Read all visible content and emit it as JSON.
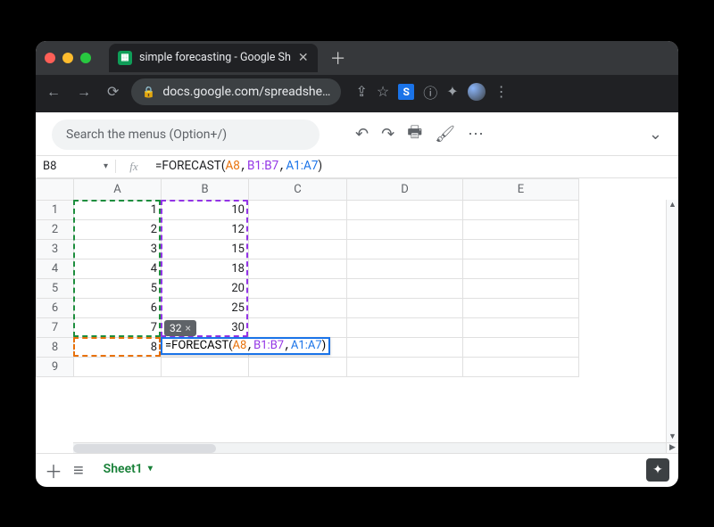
{
  "browser": {
    "tab_title": "simple forecasting - Google Sh",
    "url_display": "docs.google.com/spreadshe…"
  },
  "toolbar": {
    "search_placeholder": "Search the menus (Option+/)"
  },
  "formula_bar": {
    "namebox": "B8",
    "fx_label": "fx",
    "prefix": "=FORECAST(",
    "arg1": "A8",
    "arg2": "B1:B7",
    "arg3": "A1:A7",
    "suffix": ")"
  },
  "columns": [
    "A",
    "B",
    "C",
    "D",
    "E"
  ],
  "rows": [
    {
      "n": "1",
      "a": "1",
      "b": "10"
    },
    {
      "n": "2",
      "a": "2",
      "b": "12"
    },
    {
      "n": "3",
      "a": "3",
      "b": "15"
    },
    {
      "n": "4",
      "a": "4",
      "b": "18"
    },
    {
      "n": "5",
      "a": "5",
      "b": "20"
    },
    {
      "n": "6",
      "a": "6",
      "b": "25"
    },
    {
      "n": "7",
      "a": "7",
      "b": "30"
    },
    {
      "n": "8",
      "a": "8",
      "b": ""
    },
    {
      "n": "9",
      "a": "",
      "b": ""
    }
  ],
  "edit_cell": {
    "hint_value": "32",
    "prefix": "=FORECAST(",
    "arg1": "A8",
    "arg2": "B1:B7",
    "arg3": "A1:A7",
    "suffix": ")"
  },
  "sheet_tabs": {
    "active": "Sheet1"
  }
}
